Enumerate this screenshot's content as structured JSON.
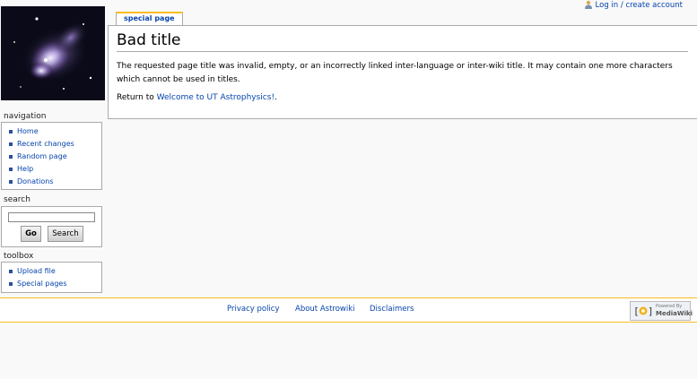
{
  "user": {
    "login_link": "Log in / create account"
  },
  "tabs": [
    {
      "label": "special page"
    }
  ],
  "page": {
    "title": "Bad title",
    "message": "The requested page title was invalid, empty, or an incorrectly linked inter-language or inter-wiki title. It may contain one more characters which cannot be used in titles.",
    "return_prefix": "Return to ",
    "return_link": "Welcome to UT Astrophysics!",
    "return_suffix": "."
  },
  "navigation": {
    "heading": "navigation",
    "items": [
      "Home",
      "Recent changes",
      "Random page",
      "Help",
      "Donations"
    ]
  },
  "search": {
    "heading": "search",
    "go_label": "Go",
    "search_label": "Search"
  },
  "toolbox": {
    "heading": "toolbox",
    "items": [
      "Upload file",
      "Special pages"
    ]
  },
  "footer": {
    "links": [
      "Privacy policy",
      "About Astrowiki",
      "Disclaimers"
    ],
    "powered_small": "Powered By",
    "powered_big": "MediaWiki"
  },
  "colors": {
    "link": "#0645ad",
    "accent": "#fabd23",
    "border": "#aaaaaa"
  }
}
